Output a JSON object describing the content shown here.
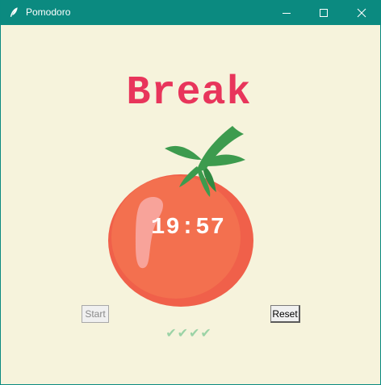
{
  "window": {
    "title": "Pomodoro",
    "titlebar_color": "#0b8a80",
    "background_color": "#f6f3dc",
    "icons": {
      "app": "feather-icon",
      "minimize": "minimize-icon",
      "maximize": "maximize-icon",
      "close": "close-icon"
    }
  },
  "main": {
    "heading": "Break",
    "heading_color": "#e8355b",
    "timer": "19:57",
    "image": "tomato-image",
    "start_label": "Start",
    "start_enabled": false,
    "reset_label": "Reset",
    "checkmarks": "✔✔✔✔",
    "checkmark_color": "#9bd3a6"
  }
}
